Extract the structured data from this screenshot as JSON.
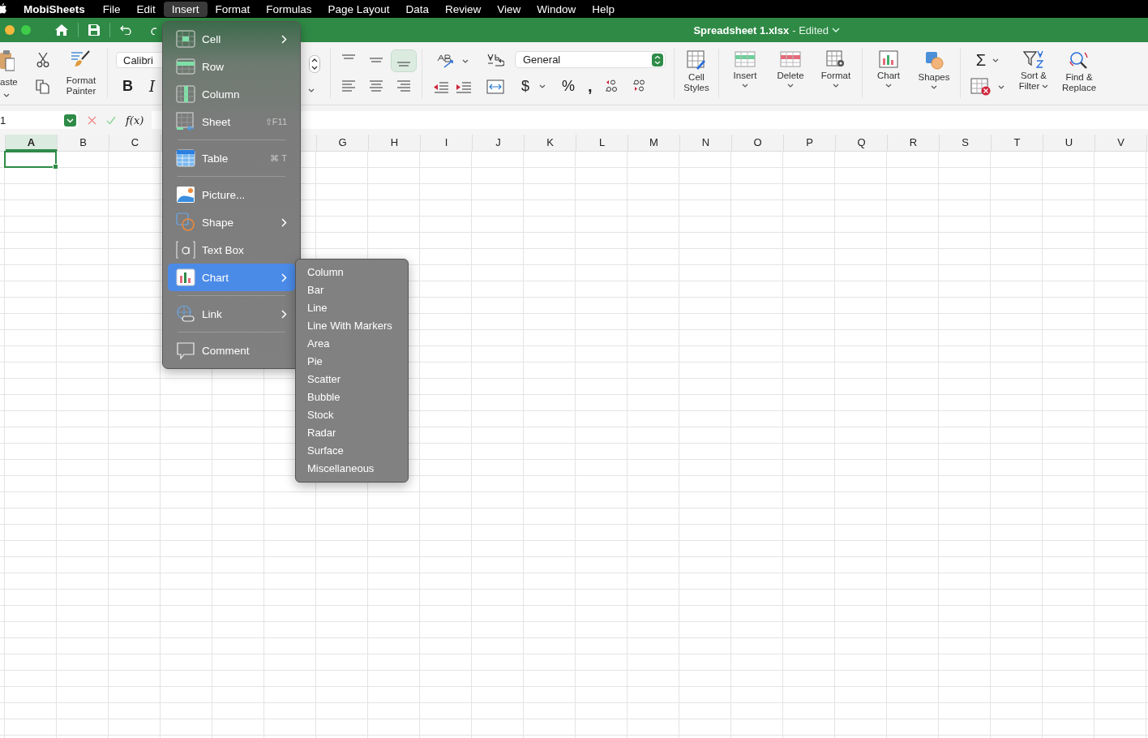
{
  "menubar": {
    "app_name": "MobiSheets",
    "items": [
      {
        "label": "File",
        "selected": false
      },
      {
        "label": "Edit",
        "selected": false
      },
      {
        "label": "Insert",
        "selected": true
      },
      {
        "label": "Format",
        "selected": false
      },
      {
        "label": "Formulas",
        "selected": false
      },
      {
        "label": "Page Layout",
        "selected": false
      },
      {
        "label": "Data",
        "selected": false
      },
      {
        "label": "Review",
        "selected": false
      },
      {
        "label": "View",
        "selected": false
      },
      {
        "label": "Window",
        "selected": false
      },
      {
        "label": "Help",
        "selected": false
      }
    ]
  },
  "titlebar": {
    "document": "Spreadsheet 1.xlsx",
    "status": "- Edited"
  },
  "ribbon": {
    "paste_label": "aste",
    "painter_label": "Format Painter",
    "font": "Calibri",
    "bold": "B",
    "italic": "I",
    "number_format": "General",
    "currency": "$",
    "percent": "%",
    "comma": ",",
    "sum": "Σ",
    "buttons": [
      {
        "label": "Cell Styles",
        "dropdown": false
      },
      {
        "label": "Insert",
        "dropdown": true
      },
      {
        "label": "Delete",
        "dropdown": true
      },
      {
        "label": "Format",
        "dropdown": true
      },
      {
        "label": "Chart",
        "dropdown": true
      },
      {
        "label": "Shapes",
        "dropdown": true
      }
    ],
    "tail_buttons": [
      {
        "label": "Sort & Filter",
        "dropdown": true
      },
      {
        "label": "Find & Replace",
        "dropdown": false
      }
    ]
  },
  "formula_bar": {
    "name_box": "1",
    "function_label": "f(x)"
  },
  "sheet": {
    "columns_left": [
      {
        "label": "A",
        "selected": true
      },
      {
        "label": "B",
        "selected": false
      },
      {
        "label": "C",
        "selected": false
      }
    ],
    "columns_right": [
      {
        "label": "G",
        "selected": false
      },
      {
        "label": "H",
        "selected": false
      },
      {
        "label": "I",
        "selected": false
      },
      {
        "label": "J",
        "selected": false
      },
      {
        "label": "K",
        "selected": false
      },
      {
        "label": "L",
        "selected": false
      },
      {
        "label": "M",
        "selected": false
      },
      {
        "label": "N",
        "selected": false
      },
      {
        "label": "O",
        "selected": false
      },
      {
        "label": "P",
        "selected": false
      },
      {
        "label": "Q",
        "selected": false
      },
      {
        "label": "R",
        "selected": false
      },
      {
        "label": "S",
        "selected": false
      },
      {
        "label": "T",
        "selected": false
      },
      {
        "label": "U",
        "selected": false
      },
      {
        "label": "V",
        "selected": false
      }
    ]
  },
  "insert_menu": {
    "items": [
      {
        "kind": "item",
        "label": "Cell",
        "submenu": true,
        "selected": false
      },
      {
        "kind": "item",
        "label": "Row",
        "submenu": false,
        "selected": false
      },
      {
        "kind": "item",
        "label": "Column",
        "submenu": false,
        "selected": false
      },
      {
        "kind": "item",
        "label": "Sheet",
        "submenu": false,
        "selected": false,
        "shortcut": "⇧F11"
      },
      {
        "kind": "separator"
      },
      {
        "kind": "item",
        "label": "Table",
        "submenu": false,
        "selected": false,
        "shortcut": "⌘ T"
      },
      {
        "kind": "separator"
      },
      {
        "kind": "item",
        "label": "Picture...",
        "submenu": false,
        "selected": false
      },
      {
        "kind": "item",
        "label": "Shape",
        "submenu": true,
        "selected": false
      },
      {
        "kind": "item",
        "label": "Text Box",
        "submenu": false,
        "selected": false
      },
      {
        "kind": "item",
        "label": "Chart",
        "submenu": true,
        "selected": true
      },
      {
        "kind": "separator"
      },
      {
        "kind": "item",
        "label": "Link",
        "submenu": true,
        "selected": false
      },
      {
        "kind": "separator"
      },
      {
        "kind": "item",
        "label": "Comment",
        "submenu": false,
        "selected": false
      }
    ]
  },
  "chart_submenu": {
    "items": [
      "Column",
      "Bar",
      "Line",
      "Line With Markers",
      "Area",
      "Pie",
      "Scatter",
      "Bubble",
      "Stock",
      "Radar",
      "Surface",
      "Miscellaneous"
    ]
  }
}
